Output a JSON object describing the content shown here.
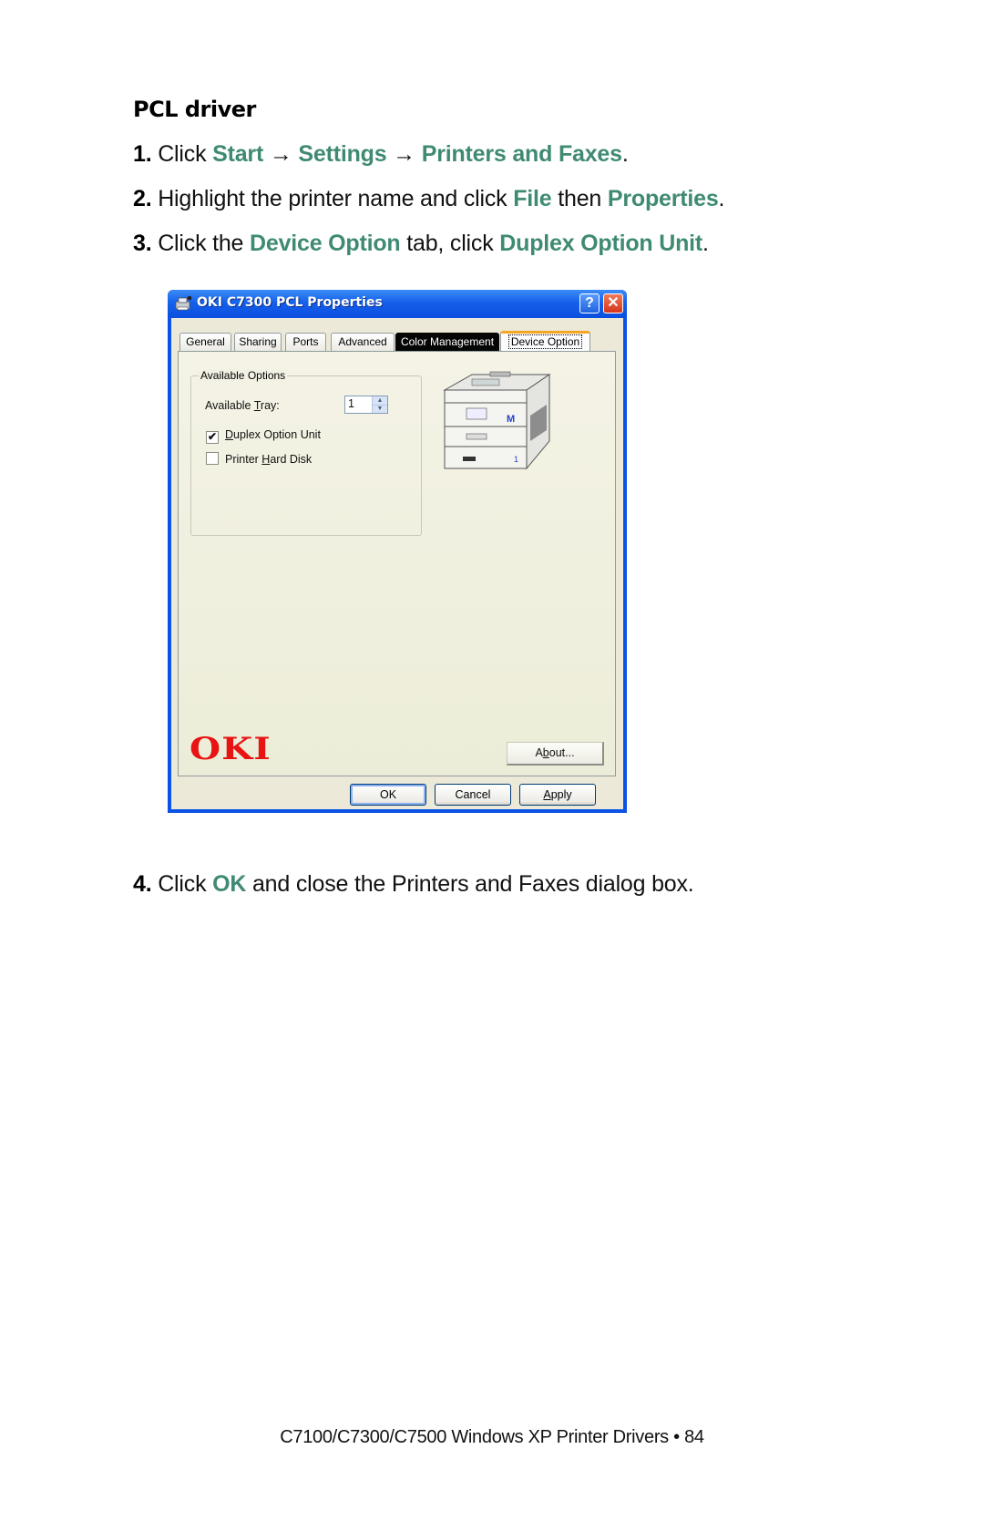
{
  "heading": "PCL driver",
  "steps": [
    {
      "num": "1.",
      "parts": [
        "Click ",
        "Start",
        " → ",
        "Settings",
        " → ",
        "Printers and Faxes",
        "."
      ]
    },
    {
      "num": "2.",
      "parts": [
        "Highlight the printer name and click ",
        "File",
        " then ",
        "Properties",
        "."
      ]
    },
    {
      "num": "3.",
      "parts": [
        "Click the ",
        "Device Option",
        " tab, click ",
        "Duplex Option Unit",
        "."
      ]
    },
    {
      "num": "4.",
      "parts": [
        "Click ",
        "OK",
        " and close the Printers and Faxes dialog box."
      ]
    }
  ],
  "dialog": {
    "title": "OKI C7300 PCL Properties",
    "help_label": "?",
    "close_label": "✕",
    "tabs": [
      {
        "label": "General"
      },
      {
        "label": "Sharing"
      },
      {
        "label": "Ports"
      },
      {
        "label": "Advanced"
      },
      {
        "label": "Color Management"
      },
      {
        "label": "Device Option",
        "active": true
      }
    ],
    "group_label": "Available Options",
    "tray_label_pre": "Available ",
    "tray_label_ul": "T",
    "tray_label_post": "ray:",
    "tray_value": "1",
    "options": [
      {
        "ul": "D",
        "rest": "uplex Option Unit",
        "pre": "",
        "checked": true
      },
      {
        "pre": "Printer ",
        "ul": "H",
        "rest": "ard Disk",
        "checked": false
      }
    ],
    "printer_labels": {
      "color_mark": "M",
      "tray_mark": "1"
    },
    "logo_text": "OKI",
    "about": {
      "pre": "A",
      "ul": "b",
      "post": "out..."
    },
    "buttons": {
      "ok": "OK",
      "cancel": "Cancel",
      "apply_ul": "A",
      "apply_rest": "pply"
    }
  },
  "colors": {
    "highlight_text": "#3f8a73",
    "xp_titlebar": "#0a53e6",
    "oki_red": "#e81313"
  },
  "footer": "C7100/C7300/C7500 Windows XP Printer Drivers • 84"
}
